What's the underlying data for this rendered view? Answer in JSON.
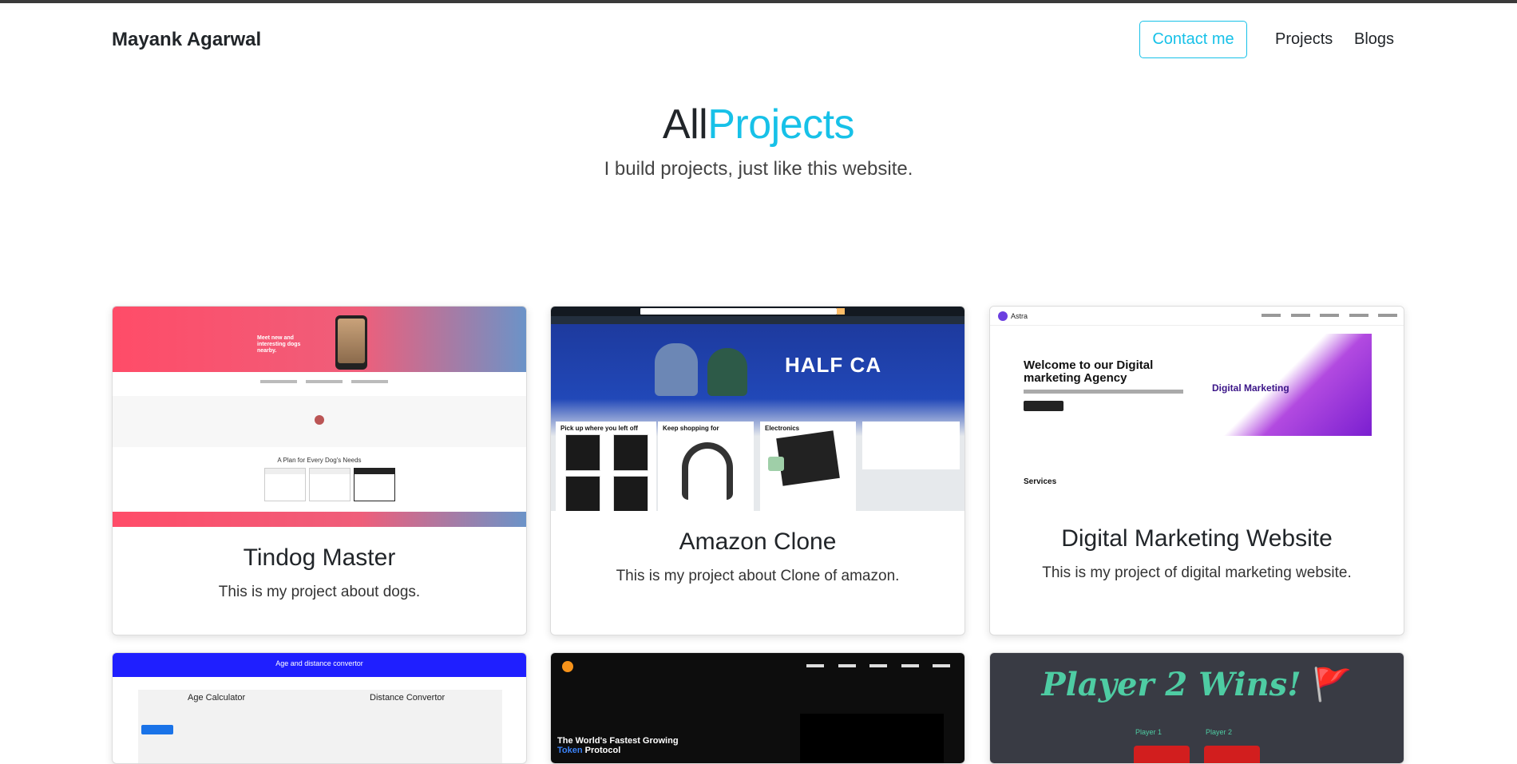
{
  "navbar": {
    "brand": "Mayank Agarwal",
    "contact_label": "Contact me",
    "links": [
      "Projects",
      "Blogs"
    ]
  },
  "hero": {
    "title_plain": "All",
    "title_accent": "Projects",
    "subtitle": "I build projects, just like this website."
  },
  "colors": {
    "accent": "#17c1e8",
    "text": "#212529",
    "topbar": "#3a3a3a"
  },
  "projects": [
    {
      "title": "Tindog Master",
      "description": "This is my project about dogs.",
      "thumb": {
        "headline": "Meet new and interesting dogs nearby.",
        "pricing_title": "A Plan for Every Dog's Needs"
      }
    },
    {
      "title": "Amazon Clone",
      "description": "This is my project about Clone of amazon.",
      "thumb": {
        "banner_text": "HALF CA",
        "box_titles": [
          "Pick up where you left off",
          "Keep shopping for",
          "Electronics"
        ]
      }
    },
    {
      "title": "Digital Marketing Website",
      "description": "This is my project of digital marketing website.",
      "thumb": {
        "brand": "Astra",
        "headline": "Welcome to our Digital marketing Agency",
        "hero_text": "Digital Marketing",
        "section": "Services"
      }
    },
    {
      "title": "",
      "description": "",
      "thumb": {
        "header": "Age and distance convertor",
        "left_title": "Age Calculator",
        "right_title": "Distance Convertor"
      }
    },
    {
      "title": "",
      "description": "",
      "thumb": {
        "headline_1": "The World's Fastest Growing",
        "headline_accent": "Token",
        "headline_2": " Protocol"
      }
    },
    {
      "title": "",
      "description": "",
      "thumb": {
        "banner": "Player 2 Wins! ",
        "flag": "🚩",
        "player_1": "Player 1",
        "player_2": "Player 2"
      }
    }
  ]
}
